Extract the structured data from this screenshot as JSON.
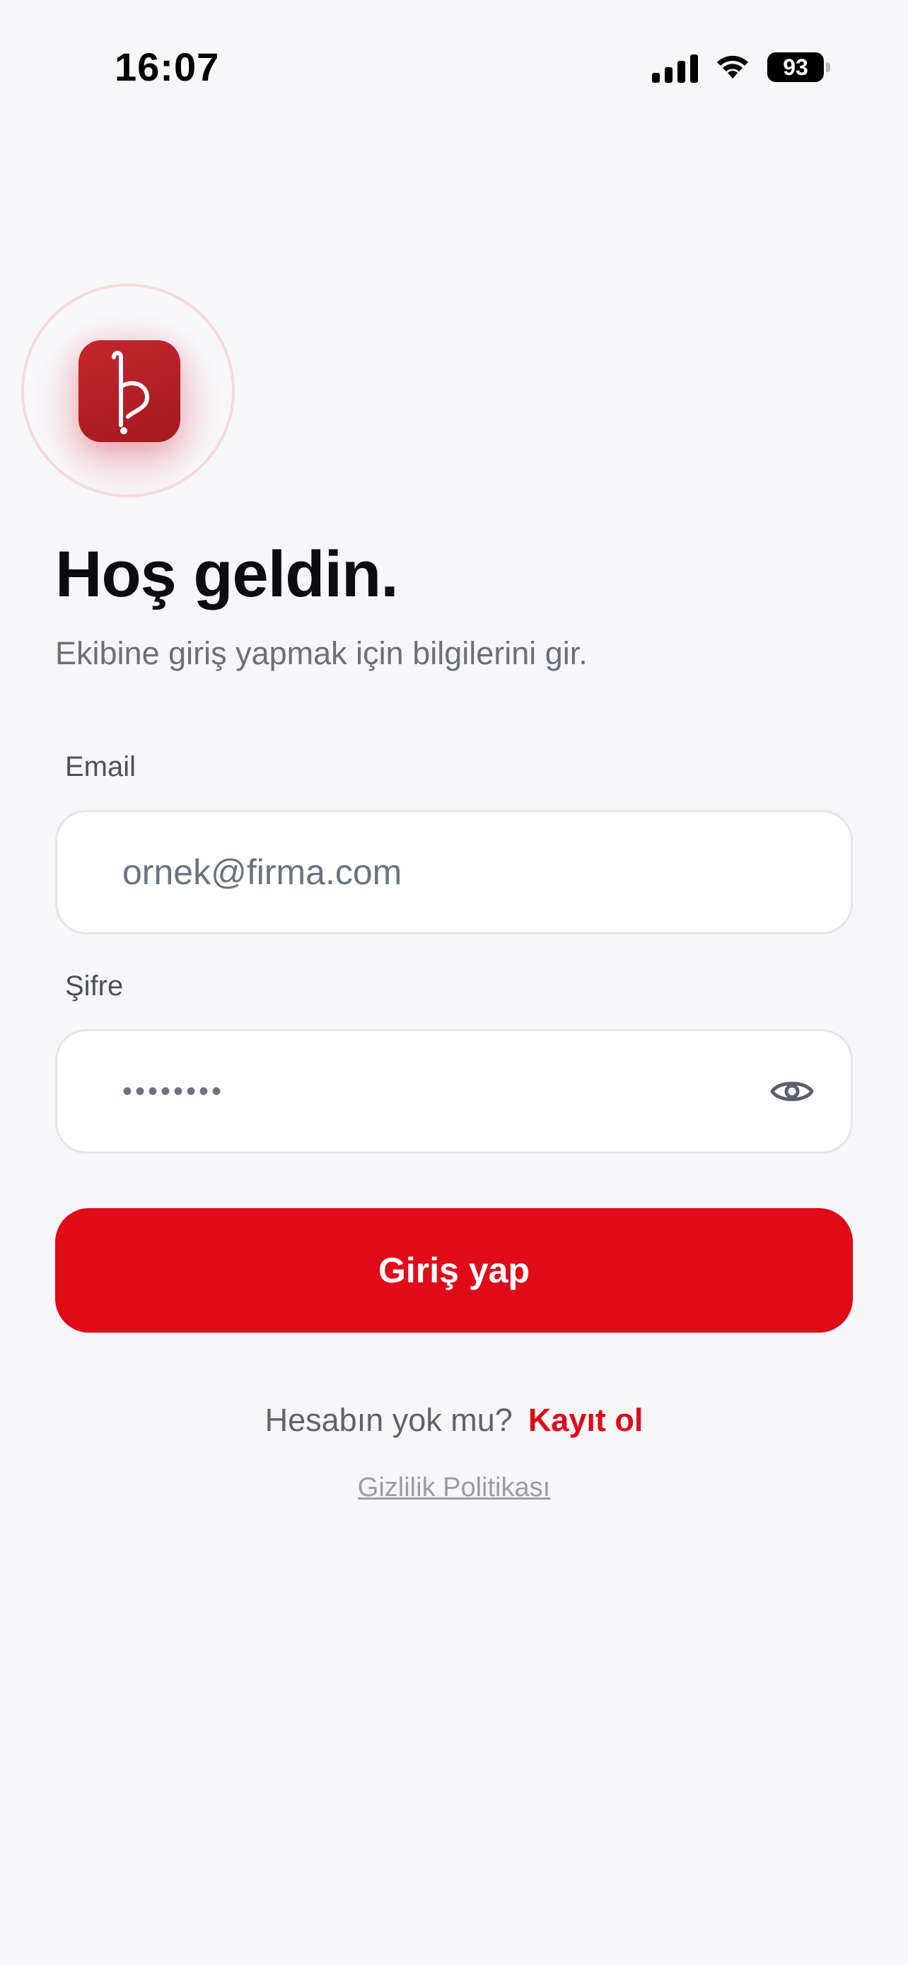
{
  "status_bar": {
    "time": "16:07",
    "battery": "93",
    "icons": [
      "signal-icon",
      "wifi-icon",
      "battery-icon"
    ]
  },
  "logo": {
    "icon": "app-logo-icon",
    "colors": {
      "primary": "#b3202a",
      "halo": "#f6dadd"
    }
  },
  "header": {
    "title": "Hoş geldin.",
    "subtitle": "Ekibine giriş yapmak için bilgilerini gir."
  },
  "form": {
    "email": {
      "label": "Email",
      "placeholder": "ornek@firma.com",
      "value": ""
    },
    "password": {
      "label": "Şifre",
      "value": "••••••••",
      "toggle_icon": "eye-icon"
    },
    "submit_label": "Giriş yap"
  },
  "footer": {
    "signup_prompt": "Hesabın yok mu?",
    "signup_link": "Kayıt ol",
    "privacy_link": "Gizlilik Politikası"
  },
  "colors": {
    "accent": "#e10a18",
    "background": "#f7f7fa",
    "muted_text": "#6b6f7a"
  }
}
